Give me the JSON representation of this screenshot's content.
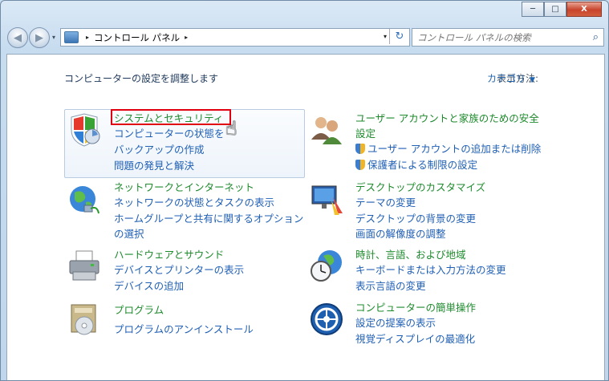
{
  "window": {
    "minimize": "─",
    "maximize": "□",
    "close": "X"
  },
  "address": {
    "crumb": "コントロール パネル",
    "sep": "▸",
    "drop": "▾",
    "refresh": "↻"
  },
  "search": {
    "placeholder": "コントロール パネルの検索",
    "icon": "search-icon"
  },
  "header": {
    "title": "コンピューターの設定を調整します",
    "view_by_label": "表示方法:",
    "view_by_value": "カテゴリ"
  },
  "categories": [
    {
      "title": "システムとセキュリティ",
      "links": [
        "コンピューターの状態を",
        "バックアップの作成",
        "問題の発見と解決"
      ],
      "icon": "shield-icon"
    },
    {
      "title": "ネットワークとインターネット",
      "links": [
        "ネットワークの状態とタスクの表示",
        "ホームグループと共有に関するオプション",
        "の選択"
      ],
      "icon": "network-globe-icon"
    },
    {
      "title": "ハードウェアとサウンド",
      "links": [
        "デバイスとプリンターの表示",
        "デバイスの追加"
      ],
      "icon": "printer-icon"
    },
    {
      "title": "プログラム",
      "links": [
        "プログラムのアンインストール"
      ],
      "icon": "programs-icon"
    },
    {
      "title": "ユーザー アカウントと家族のための安全",
      "title2": "設定",
      "links": [
        "ユーザー アカウントの追加または削除",
        "保護者による制限の設定"
      ],
      "icon": "users-icon"
    },
    {
      "title": "デスクトップのカスタマイズ",
      "links": [
        "テーマの変更",
        "デスクトップの背景の変更",
        "画面の解像度の調整"
      ],
      "icon": "desktop-icon"
    },
    {
      "title": "時計、言語、および地域",
      "links": [
        "キーボードまたは入力方法の変更",
        "表示言語の変更"
      ],
      "icon": "clock-globe-icon"
    },
    {
      "title": "コンピューターの簡単操作",
      "links": [
        "設定の提案の表示",
        "視覚ディスプレイの最適化"
      ],
      "icon": "ease-of-access-icon"
    }
  ]
}
